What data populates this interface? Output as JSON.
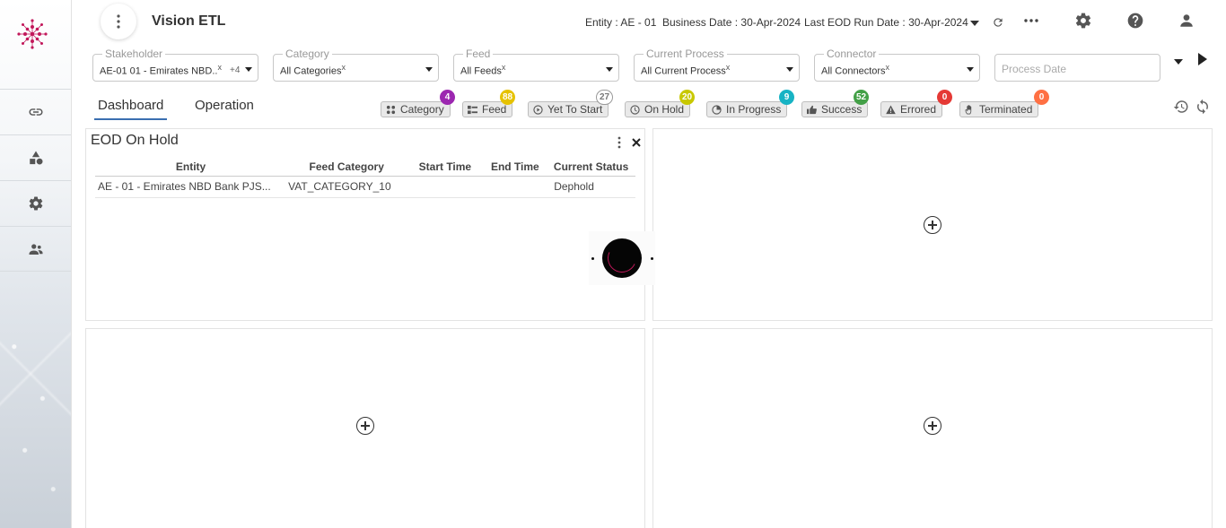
{
  "header": {
    "title": "Vision ETL",
    "entity_label": "Entity :",
    "entity_value": "AE - 01",
    "business_date_label": "Business Date :",
    "business_date_value": "30-Apr-2024",
    "last_eod_label": "Last EOD Run Date :",
    "last_eod_value": "30-Apr-2024"
  },
  "filters": {
    "stakeholder": {
      "label": "Stakeholder",
      "value": "AE-01 01 - Emirates NBD..",
      "clear": "x",
      "more": "+4"
    },
    "category": {
      "label": "Category",
      "value": "All Categories",
      "clear": "x"
    },
    "feed": {
      "label": "Feed",
      "value": "All Feeds",
      "clear": "x"
    },
    "current_process": {
      "label": "Current Process",
      "value": "All Current Process",
      "clear": "x"
    },
    "connector": {
      "label": "Connector",
      "value": "All Connectors",
      "clear": "x"
    },
    "process_date": {
      "placeholder": "Process Date"
    }
  },
  "tabs": [
    {
      "label": "Dashboard",
      "active": true
    },
    {
      "label": "Operation",
      "active": false
    }
  ],
  "status_chips": [
    {
      "label": "Category",
      "count": "4",
      "color": "#9c27b0",
      "icon": "grid-icon"
    },
    {
      "label": "Feed",
      "count": "88",
      "color": "#e6c200",
      "icon": "list-icon"
    },
    {
      "label": "Yet To Start",
      "count": "27",
      "color": "outline",
      "icon": "play-circle-icon"
    },
    {
      "label": "On Hold",
      "count": "20",
      "color": "#c8c800",
      "icon": "clock-icon"
    },
    {
      "label": "In Progress",
      "count": "9",
      "color": "#17b3c4",
      "icon": "pie-icon"
    },
    {
      "label": "Success",
      "count": "52",
      "color": "#43a047",
      "icon": "thumbs-up-icon"
    },
    {
      "label": "Errored",
      "count": "0",
      "color": "#e53935",
      "icon": "warning-icon"
    },
    {
      "label": "Terminated",
      "count": "0",
      "color": "#ff7043",
      "icon": "hand-icon"
    }
  ],
  "eod_panel": {
    "title": "EOD On Hold",
    "columns": [
      "Entity",
      "Feed Category",
      "Start Time",
      "End Time",
      "Current Status"
    ],
    "rows": [
      [
        "AE - 01 - Emirates NBD Bank PJS...",
        "VAT_CATEGORY_10",
        "",
        "",
        "Dephold"
      ]
    ]
  },
  "sidebar": {
    "items": [
      {
        "icon": "link-icon"
      },
      {
        "icon": "shapes-icon"
      },
      {
        "icon": "gear-icon"
      },
      {
        "icon": "users-icon"
      }
    ]
  }
}
